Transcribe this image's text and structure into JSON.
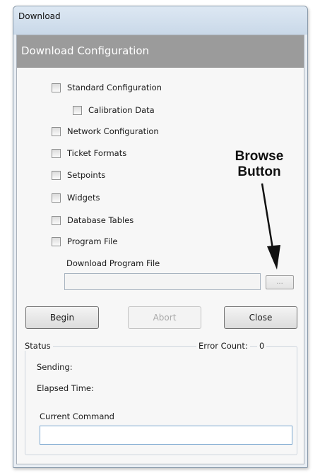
{
  "window": {
    "title": "Download"
  },
  "header": {
    "title": "Download Configuration"
  },
  "options": {
    "standard_configuration": "Standard Configuration",
    "calibration_data": "Calibration Data",
    "network_configuration": "Network Configuration",
    "ticket_formats": "Ticket Formats",
    "setpoints": "Setpoints",
    "widgets": "Widgets",
    "database_tables": "Database Tables",
    "program_file": "Program File"
  },
  "program_file_field": {
    "label": "Download Program File",
    "value": "",
    "browse_label": "..."
  },
  "buttons": {
    "begin": "Begin",
    "abort": "Abort",
    "close": "Close"
  },
  "status": {
    "caption": "Status",
    "error_count_label": "Error Count:",
    "error_count": "0",
    "sending_label": "Sending:",
    "elapsed_time_label": "Elapsed Time:",
    "current_command_label": "Current Command",
    "current_command_value": ""
  },
  "annotation": {
    "line1": "Browse",
    "line2": "Button"
  }
}
